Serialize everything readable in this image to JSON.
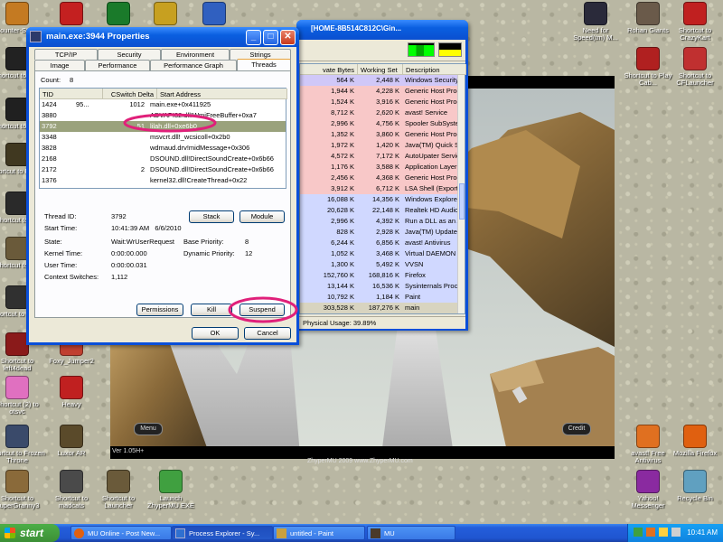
{
  "desktop": {
    "left_icons": [
      {
        "label": "Counter-Strike",
        "color": "#c47a22"
      },
      {
        "label": "Shortcut to cmd",
        "color": "#222222"
      },
      {
        "label": "Shortcut to gtav",
        "color": "#202020"
      },
      {
        "label": "Shortcut to Prince",
        "color": "#403820"
      },
      {
        "label": "Shortcut to TH",
        "color": "#2a2a2a"
      },
      {
        "label": "Shortcut to gta",
        "color": "#6a5a3a"
      },
      {
        "label": "Shortcut to inbak",
        "color": "#303030"
      },
      {
        "label": "Shortcut to left4dead",
        "color": "#8a1a1a"
      },
      {
        "label": "Shortcut (2) to otsvc",
        "color": "#e070c0"
      },
      {
        "label": "Shortcut to Frozen Throne",
        "color": "#3a4a6a"
      },
      {
        "label": "Shortcut to SuperGranny3",
        "color": "#8a6a3a"
      }
    ],
    "col2_icons": [
      {
        "label": "Foxy_Jumper2",
        "color": "#c04030"
      },
      {
        "label": "Heavy",
        "color": "#c02020"
      },
      {
        "label": "Luxor AR",
        "color": "#5a4a2a"
      },
      {
        "label": "Shortcut to madcats",
        "color": "#4a4a4a"
      }
    ],
    "bottom_icons": [
      {
        "label": "Shortcut to Launcher",
        "color": "#6a5a3a"
      },
      {
        "label": "Launch ZhyperMU.EXE",
        "color": "#40a040"
      }
    ],
    "top_icons": [
      {
        "label": "",
        "color": "#c42020"
      },
      {
        "label": "",
        "color": "#1a7a2a"
      },
      {
        "label": "",
        "color": "#c7a020"
      },
      {
        "label": "",
        "color": "#3060c0"
      }
    ],
    "right_icons": [
      {
        "label": "Need for Speed(tm) M...",
        "color": "#2a2a3a"
      },
      {
        "label": "Rohan Giants",
        "color": "#6a5a4a"
      },
      {
        "label": "Shortcut to CrazyKart",
        "color": "#c02020"
      },
      {
        "label": "Shortcut to Play Cab...",
        "color": "#b02020"
      },
      {
        "label": "Shortcut to CFLauncher",
        "color": "#c03030"
      },
      {
        "label": "avast! Free Antivirus",
        "color": "#e07020"
      },
      {
        "label": "Mozilla Firefox",
        "color": "#e06010"
      },
      {
        "label": "Yahoo! Messenger",
        "color": "#8a2aa0"
      },
      {
        "label": "Recycle Bin",
        "color": "#60a0c0"
      }
    ]
  },
  "properties": {
    "title": "main.exe:3944 Properties",
    "tabs_back": [
      "TCP/IP",
      "Security",
      "Environment",
      "Strings"
    ],
    "tabs_front": [
      "Image",
      "Performance",
      "Performance Graph",
      "Threads"
    ],
    "count_label": "Count:",
    "count_value": "8",
    "columns": [
      "TID",
      "CSwitch Delta",
      "Start Address"
    ],
    "threads": [
      {
        "tid": "1424",
        "cpu": "95...",
        "delta": "1012",
        "addr": "main.exe+0x411925"
      },
      {
        "tid": "3880",
        "cpu": "",
        "delta": "",
        "addr": "ADVAPI32.dll!WmiFreeBuffer+0xa7"
      },
      {
        "tid": "3792",
        "cpu": "",
        "delta": "51",
        "addr": "lilah.dll+0xe6b0"
      },
      {
        "tid": "3348",
        "cpu": "",
        "delta": "",
        "addr": "msvcrt.dll!_wcsicoll+0x2b0"
      },
      {
        "tid": "3828",
        "cpu": "",
        "delta": "",
        "addr": "wdmaud.drv!midMessage+0x306"
      },
      {
        "tid": "2168",
        "cpu": "",
        "delta": "",
        "addr": "DSOUND.dll!DirectSoundCreate+0x6b66"
      },
      {
        "tid": "2172",
        "cpu": "",
        "delta": "2",
        "addr": "DSOUND.dll!DirectSoundCreate+0x6b66"
      },
      {
        "tid": "1376",
        "cpu": "",
        "delta": "",
        "addr": "kernel32.dll!CreateThread+0x22"
      }
    ],
    "thread_id_label": "Thread ID:",
    "thread_id": "3792",
    "start_time_label": "Start Time:",
    "start_time": "10:41:39 AM   6/6/2010",
    "state_label": "State:",
    "state": "Wait:WrUserRequest",
    "base_priority_label": "Base Priority:",
    "base_priority": "8",
    "kernel_time_label": "Kernel Time:",
    "kernel_time": "0:00:00.000",
    "dynamic_priority_label": "Dynamic Priority:",
    "dynamic_priority": "12",
    "user_time_label": "User Time:",
    "user_time": "0:00:00.031",
    "context_switches_label": "Context Switches:",
    "context_switches": "1,112",
    "stack_btn": "Stack",
    "module_btn": "Module",
    "permissions_btn": "Permissions",
    "kill_btn": "Kill",
    "suspend_btn": "Suspend",
    "ok_btn": "OK",
    "cancel_btn": "Cancel"
  },
  "procexp": {
    "title": "[HOME-8B514C812C\\Gin...",
    "columns": [
      "vate Bytes",
      "Working Set",
      "Description"
    ],
    "rows": [
      {
        "priv": "564 K",
        "ws": "2,448 K",
        "desc": "Windows Security C",
        "bg": "#d0c8f8"
      },
      {
        "priv": "1,944 K",
        "ws": "4,228 K",
        "desc": "Generic Host Proce",
        "bg": "#f8c8c8"
      },
      {
        "priv": "1,524 K",
        "ws": "3,916 K",
        "desc": "Generic Host Proce",
        "bg": "#f8c8c8"
      },
      {
        "priv": "8,712 K",
        "ws": "2,620 K",
        "desc": "avast! Service",
        "bg": "#f8c8c8"
      },
      {
        "priv": "2,996 K",
        "ws": "4,756 K",
        "desc": "Spooler SubSystem",
        "bg": "#f8c8c8"
      },
      {
        "priv": "1,352 K",
        "ws": "3,860 K",
        "desc": "Generic Host Proce",
        "bg": "#f8c8c8"
      },
      {
        "priv": "1,972 K",
        "ws": "1,420 K",
        "desc": "Java(TM) Quick St",
        "bg": "#f8c8c8"
      },
      {
        "priv": "4,572 K",
        "ws": "7,172 K",
        "desc": "AutoUpater Service",
        "bg": "#f8c8c8"
      },
      {
        "priv": "1,176 K",
        "ws": "3,588 K",
        "desc": "Application Layer G",
        "bg": "#f8c8c8"
      },
      {
        "priv": "2,456 K",
        "ws": "4,368 K",
        "desc": "Generic Host Proce",
        "bg": "#f8c8c8"
      },
      {
        "priv": "3,912 K",
        "ws": "6,712 K",
        "desc": "LSA Shell (Export V",
        "bg": "#f8c8c8"
      },
      {
        "priv": "16,088 K",
        "ws": "14,356 K",
        "desc": "Windows Explorer",
        "bg": "#d0d8ff"
      },
      {
        "priv": "20,628 K",
        "ws": "22,148 K",
        "desc": "Realtek HD Audio (",
        "bg": "#d0d8ff"
      },
      {
        "priv": "2,996 K",
        "ws": "4,392 K",
        "desc": "Run a DLL as an A",
        "bg": "#d0d8ff"
      },
      {
        "priv": "828 K",
        "ws": "2,928 K",
        "desc": "Java(TM) Update S",
        "bg": "#d0d8ff"
      },
      {
        "priv": "6,244 K",
        "ws": "6,856 K",
        "desc": "avast! Antivirus",
        "bg": "#d0d8ff"
      },
      {
        "priv": "1,052 K",
        "ws": "3,468 K",
        "desc": "Virtual DAEMON M",
        "bg": "#d0d8ff"
      },
      {
        "priv": "1,300 K",
        "ws": "5,492 K",
        "desc": "VVSN",
        "bg": "#d0d8ff"
      },
      {
        "priv": "152,760 K",
        "ws": "168,816 K",
        "desc": "Firefox",
        "bg": "#d0d8ff"
      },
      {
        "priv": "13,144 K",
        "ws": "16,536 K",
        "desc": "Sysinternals Proces",
        "bg": "#d0d8ff"
      },
      {
        "priv": "10,792 K",
        "ws": "1,184 K",
        "desc": "Paint",
        "bg": "#d0d8ff"
      },
      {
        "priv": "303,528 K",
        "ws": "187,276 K",
        "desc": "main",
        "bg": "#d8d4c0"
      }
    ],
    "status": "Physical Usage: 39.89%"
  },
  "game": {
    "menu_btn": "Menu",
    "credit_btn": "Credit",
    "version": "Ver 1.05H+",
    "footer": "ZhyperMU 2009 www.ZhyperMU.com"
  },
  "taskbar": {
    "start": "start",
    "tasks": [
      "MU Online - Post New...",
      "Process Explorer - Sy...",
      "untitled - Paint",
      "MU"
    ],
    "time": "10:41 AM"
  }
}
